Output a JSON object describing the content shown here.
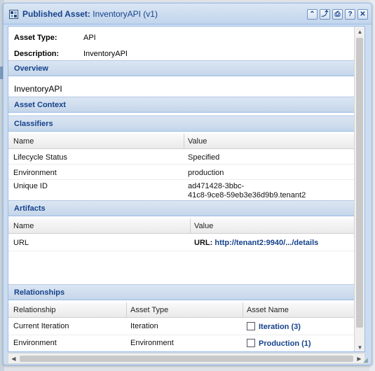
{
  "window": {
    "title_bold": "Published Asset:",
    "title_normal": "InventoryAPI (v1)"
  },
  "tools": [
    "collapse-icon",
    "export-icon",
    "print-icon",
    "help-icon",
    "close-icon"
  ],
  "summary": {
    "asset_type_label": "Asset Type:",
    "asset_type_value": "API",
    "description_label": "Description:",
    "description_value": "InventoryAPI"
  },
  "overview": {
    "header": "Overview",
    "text": "InventoryAPI"
  },
  "asset_context": {
    "header": "Asset Context"
  },
  "classifiers": {
    "header": "Classifiers",
    "columns": [
      "Name",
      "Value"
    ],
    "rows": [
      {
        "name": "Lifecycle Status",
        "value": "Specified"
      },
      {
        "name": "Environment",
        "value": "production"
      },
      {
        "name": "Unique ID",
        "value_line1": "ad471428-3bbc-",
        "value_line2": "41c8-9ce8-59eb3e36d9b9.tenant2"
      }
    ]
  },
  "artifacts": {
    "header": "Artifacts",
    "columns": [
      "Name",
      "Value"
    ],
    "rows": [
      {
        "name": "URL",
        "value_label": "URL:",
        "value_link": "http://tenant2:9940/.../details"
      }
    ]
  },
  "relationships": {
    "header": "Relationships",
    "columns": [
      "Relationship",
      "Asset Type",
      "Asset Name"
    ],
    "rows": [
      {
        "relationship": "Current Iteration",
        "asset_type": "Iteration",
        "asset_name": "Iteration (3)"
      },
      {
        "relationship": "Environment",
        "asset_type": "Environment",
        "asset_name": "Production (1)"
      }
    ]
  },
  "colors": {
    "header_text": "#15428b",
    "border": "#99bbe8"
  }
}
